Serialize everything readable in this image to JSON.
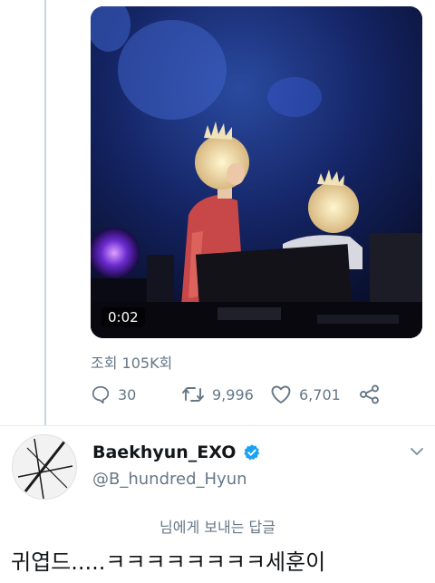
{
  "media": {
    "duration": "0:02"
  },
  "tweet": {
    "views": "조회 105K회",
    "stats": {
      "replies": "30",
      "retweets": "9,996",
      "likes": "6,701"
    }
  },
  "reply": {
    "display_name": "Baekhyun_EXO",
    "handle": "@B_hundred_Hyun",
    "replying_to": "님에게 보내는 답글",
    "text": "귀엽드.....ㅋㅋㅋㅋㅋㅋㅋㅋ세훈이"
  },
  "icons": {
    "reply": "reply-icon",
    "retweet": "retweet-icon",
    "like": "heart-icon",
    "share": "share-icon",
    "verified": "verified-badge-icon",
    "more": "chevron-down-icon"
  },
  "colors": {
    "primary_text": "#14171a",
    "secondary_text": "#657786",
    "verified_blue": "#1da1f2",
    "divider": "#e6ecf0"
  }
}
